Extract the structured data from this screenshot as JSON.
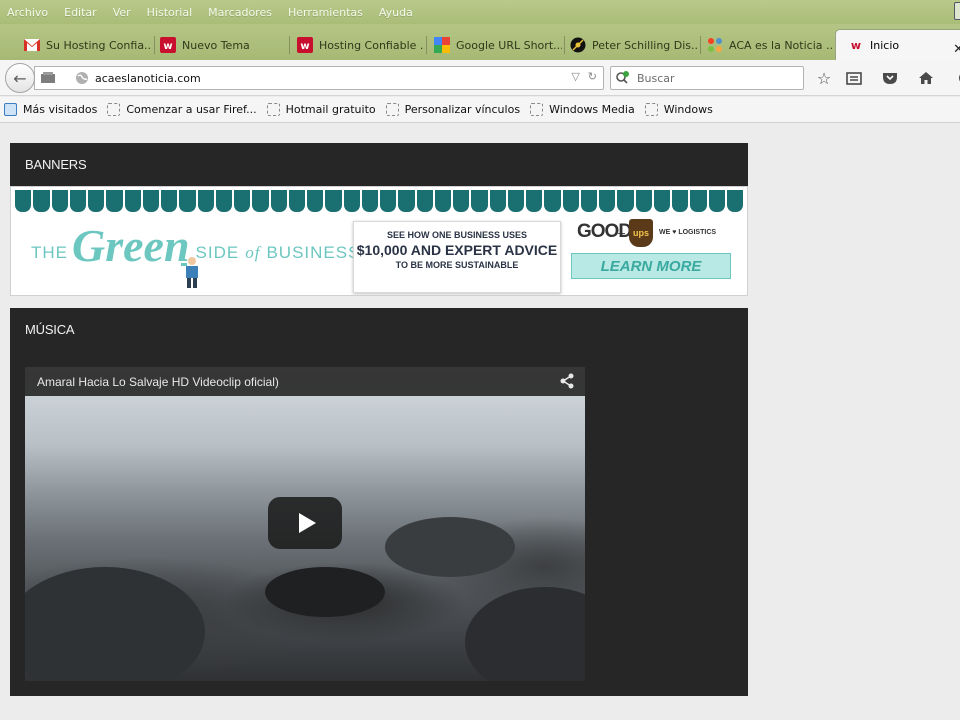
{
  "menubar": {
    "items": [
      {
        "label": "Archivo",
        "access": "A"
      },
      {
        "label": "Editar",
        "access": "E"
      },
      {
        "label": "Ver",
        "access": "V"
      },
      {
        "label": "Historial",
        "access": "s"
      },
      {
        "label": "Marcadores",
        "access": "M"
      },
      {
        "label": "Herramientas",
        "access": "t"
      },
      {
        "label": "Ayuda",
        "access": "y"
      }
    ]
  },
  "tabs": [
    {
      "label": "Su Hosting Confia...",
      "icon": "gmail-icon"
    },
    {
      "label": "Nuevo Tema",
      "icon": "w-site-icon"
    },
    {
      "label": "Hosting Confiable ...",
      "icon": "w-site-icon"
    },
    {
      "label": "Google URL Short...",
      "icon": "google-icon"
    },
    {
      "label": "Peter Schilling Dis...",
      "icon": "disc-icon"
    },
    {
      "label": "ACA es la Noticia ...",
      "icon": "joomla-icon"
    },
    {
      "label": "Inicio",
      "icon": "w-site-icon",
      "active": true
    }
  ],
  "tab_close": "✕",
  "navbar": {
    "url": "acaeslanoticia.com",
    "search_placeholder": "Buscar"
  },
  "bookmarks": [
    {
      "label": "Más visitados"
    },
    {
      "label": "Comenzar a usar Firef..."
    },
    {
      "label": "Hotmail gratuito"
    },
    {
      "label": "Personalizar vínculos"
    },
    {
      "label": "Windows Media"
    },
    {
      "label": "Windows"
    }
  ],
  "page": {
    "banners_title": "BANNERS",
    "musica_title": "MÚSICA",
    "banner": {
      "the": "THE",
      "green": "Green",
      "side": "SIDE",
      "of": "of",
      "business": "BUSINESS",
      "card_line1": "SEE HOW ONE BUSINESS USES",
      "card_line2": "$10,000 AND EXPERT ADVICE",
      "card_line3": "TO BE MORE SUSTAINABLE",
      "good": "GOOD",
      "plus": "+",
      "ups": "ups",
      "we_love": "WE ♥ LOGISTICS",
      "learn_more": "LEARN MORE"
    },
    "video": {
      "title": "Amaral   Hacia Lo Salvaje HD Videoclip oficial)"
    }
  },
  "colors": {
    "menubar": "#b9c98a",
    "widget_bg": "#262626",
    "awning": "#1a6f70",
    "banner_accent": "#6cc7c0"
  }
}
